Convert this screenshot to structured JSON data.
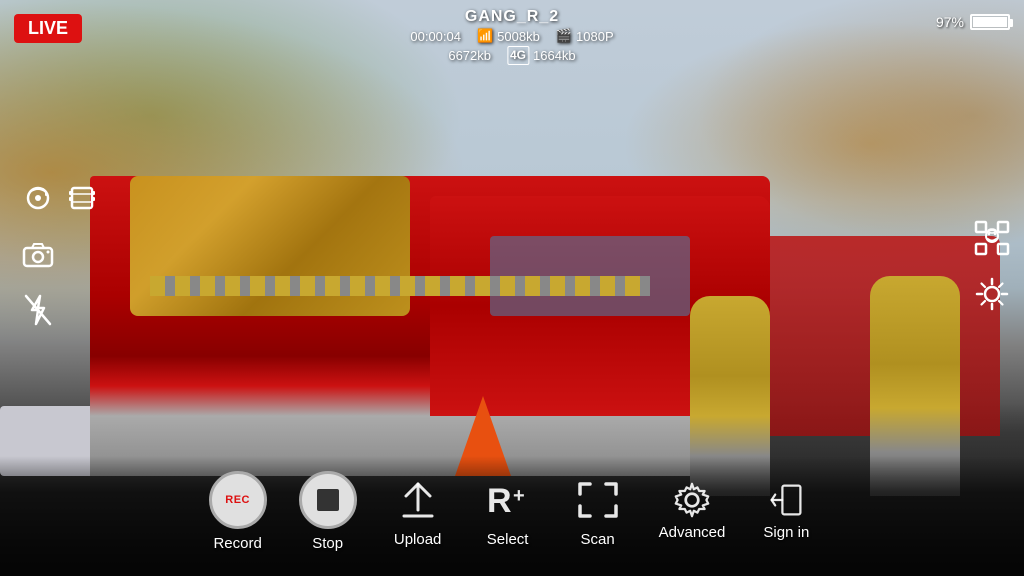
{
  "live_badge": "LIVE",
  "stream": {
    "name": "GANG_R_2",
    "timecode": "00:00:04",
    "wifi_speed": "5008kb",
    "resolution": "1080P",
    "data_used": "6672kb",
    "network_label": "4G",
    "network_speed": "1664kb"
  },
  "battery": {
    "percent": "97%"
  },
  "left_icons": {
    "camera360_label": "360-camera-icon",
    "film_label": "film-icon",
    "snapshot_label": "snapshot-icon",
    "flash_label": "flash-off-icon"
  },
  "right_icons": {
    "face_detect_label": "face-detect-icon",
    "brightness_label": "brightness-icon"
  },
  "controls": [
    {
      "id": "record",
      "icon_type": "rec",
      "label": "Record"
    },
    {
      "id": "stop",
      "icon_type": "stop",
      "label": "Stop"
    },
    {
      "id": "upload",
      "icon_type": "upload",
      "label": "Upload"
    },
    {
      "id": "select",
      "icon_type": "select",
      "label": "Select"
    },
    {
      "id": "scan",
      "icon_type": "scan",
      "label": "Scan"
    },
    {
      "id": "advanced",
      "icon_type": "gear",
      "label": "Advanced"
    },
    {
      "id": "signin",
      "icon_type": "signin",
      "label": "Sign in"
    }
  ]
}
